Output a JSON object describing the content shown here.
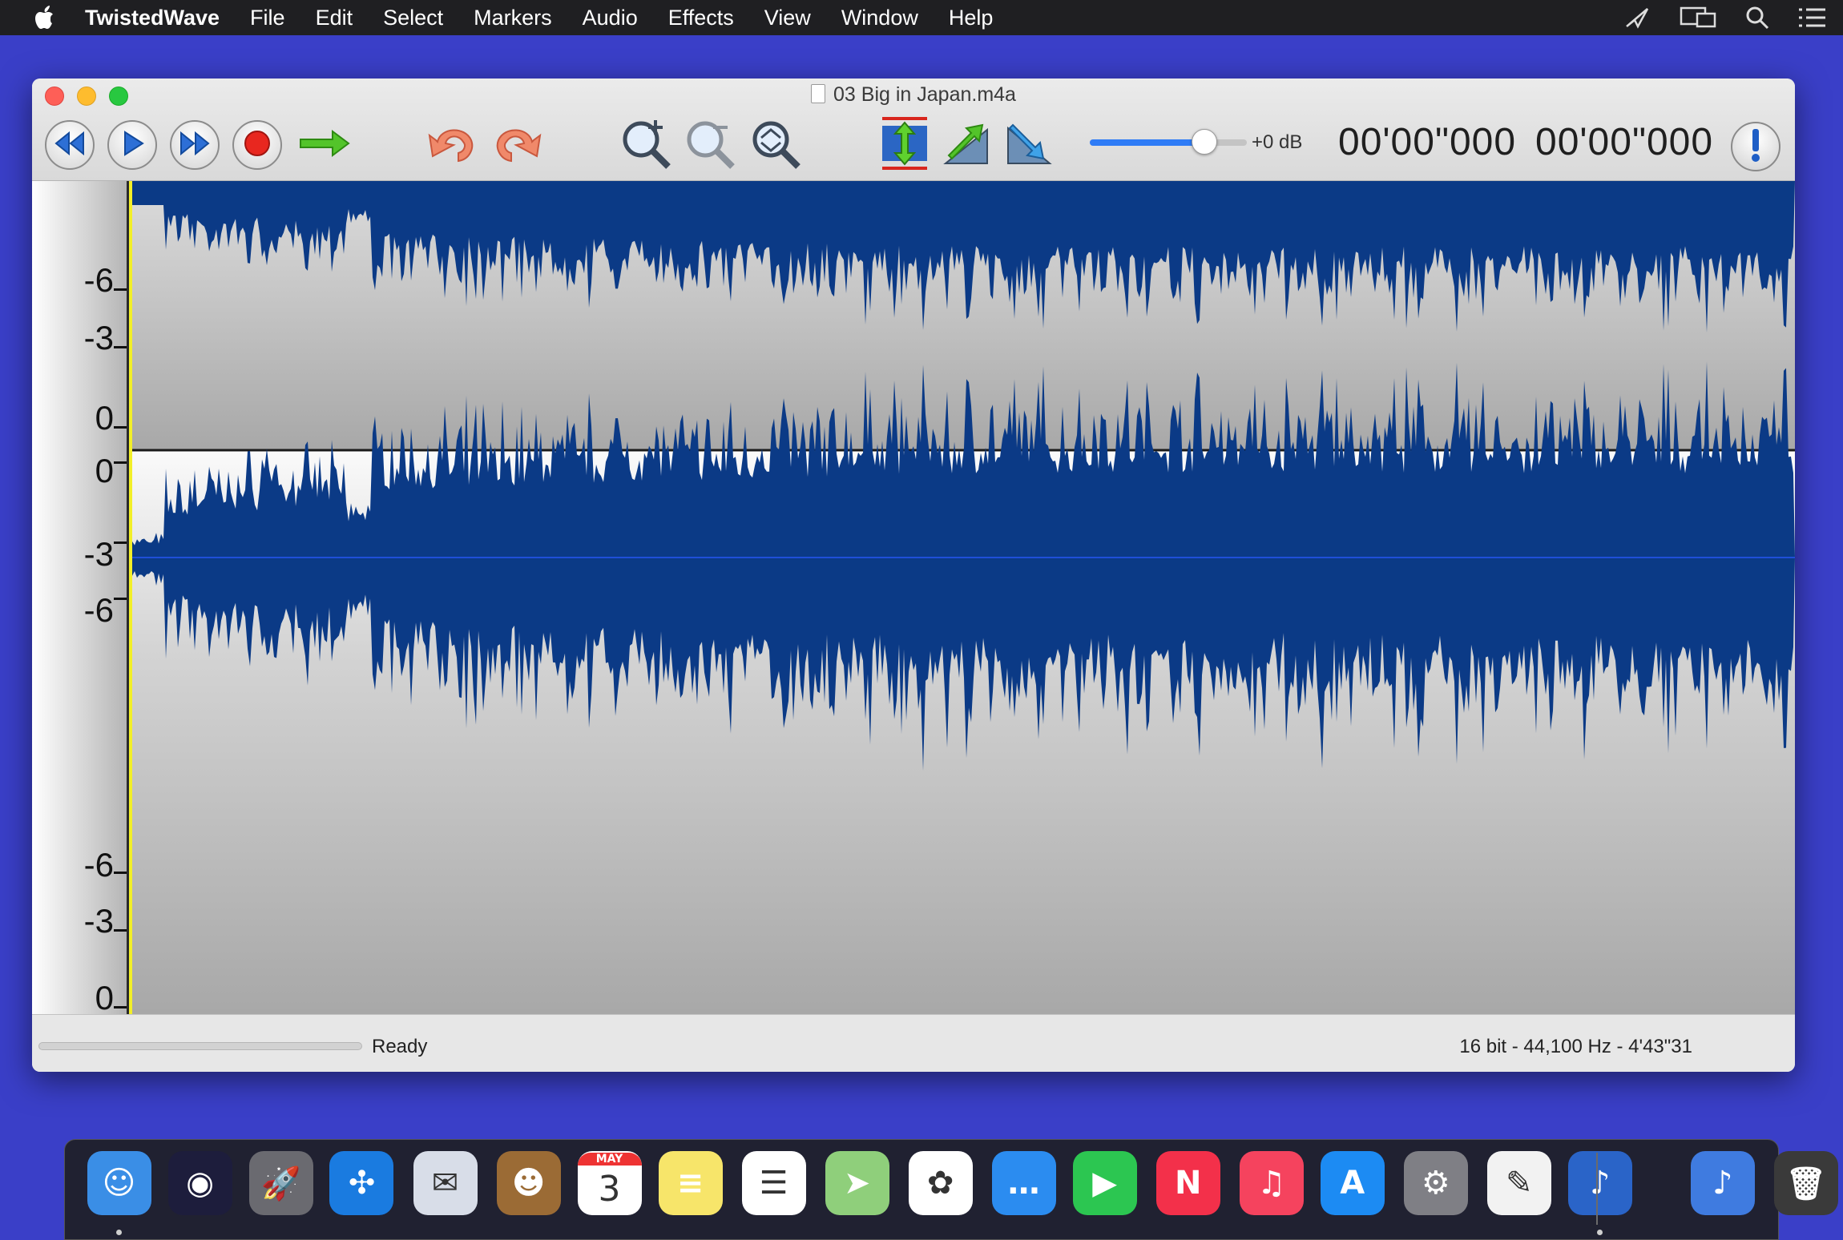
{
  "menubar": {
    "app_name": "TwistedWave",
    "items": [
      "File",
      "Edit",
      "Select",
      "Markers",
      "Audio",
      "Effects",
      "View",
      "Window",
      "Help"
    ]
  },
  "window": {
    "title": "03 Big in Japan.m4a",
    "gain_label": "+0 dB",
    "gain_level": 0.73,
    "time_position": "00'00\"000",
    "time_selection": "00'00\"000"
  },
  "ruler": {
    "top_channel": [
      "-6",
      "-3",
      "0"
    ],
    "bottom_channel_upper": [
      "0",
      "-3",
      "-6"
    ],
    "bottom_channel_lower": [
      "-6",
      "-3",
      "0"
    ]
  },
  "statusbar": {
    "status": "Ready",
    "format": "16 bit - 44,100 Hz - 4'43\"31"
  },
  "colors": {
    "waveform": "#0b3a86",
    "playhead": "#f2ef28",
    "desktop": "#3a3fc8"
  },
  "dock": {
    "apps": [
      {
        "name": "finder",
        "color": "#3a8ee6",
        "glyph": "☺"
      },
      {
        "name": "siri",
        "color": "#1d1d3c",
        "glyph": "◉"
      },
      {
        "name": "launchpad",
        "color": "#6a6a70",
        "glyph": "🚀"
      },
      {
        "name": "safari",
        "color": "#1a7be0",
        "glyph": "✣"
      },
      {
        "name": "mail",
        "color": "#d8dde8",
        "glyph": "✉"
      },
      {
        "name": "contacts",
        "color": "#9b6b35",
        "glyph": "☻"
      },
      {
        "name": "calendar",
        "color": "#ffffff",
        "glyph": "3",
        "month": "MAY"
      },
      {
        "name": "notes",
        "color": "#f7e56a",
        "glyph": "≡"
      },
      {
        "name": "reminders",
        "color": "#ffffff",
        "glyph": "☰"
      },
      {
        "name": "maps",
        "color": "#8fcf7b",
        "glyph": "➤"
      },
      {
        "name": "photos",
        "color": "#ffffff",
        "glyph": "✿"
      },
      {
        "name": "messages",
        "color": "#2b8cf0",
        "glyph": "…"
      },
      {
        "name": "facetime",
        "color": "#2cc651",
        "glyph": "▶"
      },
      {
        "name": "news",
        "color": "#f3304a",
        "glyph": "N"
      },
      {
        "name": "music",
        "color": "#f5435e",
        "glyph": "♫"
      },
      {
        "name": "app-store",
        "color": "#1c8bf3",
        "glyph": "A"
      },
      {
        "name": "system-preferences",
        "color": "#7f7f85",
        "glyph": "⚙"
      },
      {
        "name": "textedit",
        "color": "#f2f2f2",
        "glyph": "✎"
      },
      {
        "name": "twistedwave",
        "color": "#2a64c8",
        "glyph": "♪"
      },
      {
        "name": "twistedwave-doc",
        "color": "#3f7be0",
        "glyph": "♪"
      },
      {
        "name": "trash",
        "color": "#3a3a3a",
        "glyph": "🗑"
      }
    ]
  }
}
